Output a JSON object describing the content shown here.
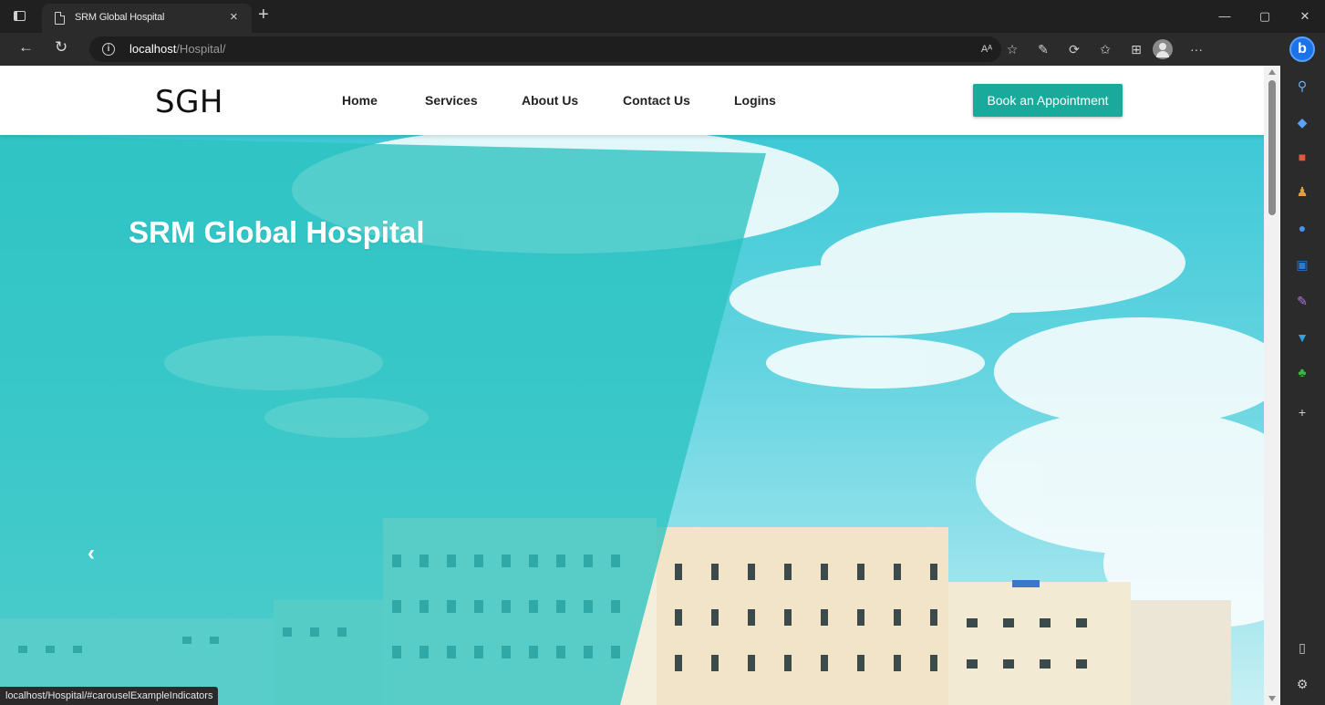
{
  "browser": {
    "tab_title": "SRM Global Hospital",
    "tab_close": "×",
    "new_tab": "+",
    "url_host": "localhost",
    "url_path": "/Hospital/",
    "status_url": "localhost/Hospital/#carouselExampleIndicators",
    "window_controls": [
      "—",
      "▢",
      "✕"
    ],
    "toolbar_icons": [
      "read-aloud-icon",
      "favorites-add-icon",
      "pen-icon",
      "extensions-icon",
      "favorites-icon",
      "collections-icon",
      "profile-icon",
      "more-icon"
    ],
    "read_aloud_label": "Aᴬ",
    "more_label": "···"
  },
  "sidebar": {
    "items": [
      "search-icon",
      "tag-icon",
      "toolbox-icon",
      "people-icon",
      "copilot-icon",
      "outlook-icon",
      "designer-icon",
      "telegram-icon",
      "tree-icon",
      "add-icon"
    ],
    "bottom": [
      "sidebar-toggle-icon",
      "settings-icon"
    ]
  },
  "site": {
    "logo": "SGH",
    "nav": [
      "Home",
      "Services",
      "About Us",
      "Contact Us",
      "Logins"
    ],
    "cta": "Book an Appointment",
    "hero_title": "SRM Global Hospital",
    "carousel_prev": "‹",
    "accent": "#1aaa9c"
  }
}
